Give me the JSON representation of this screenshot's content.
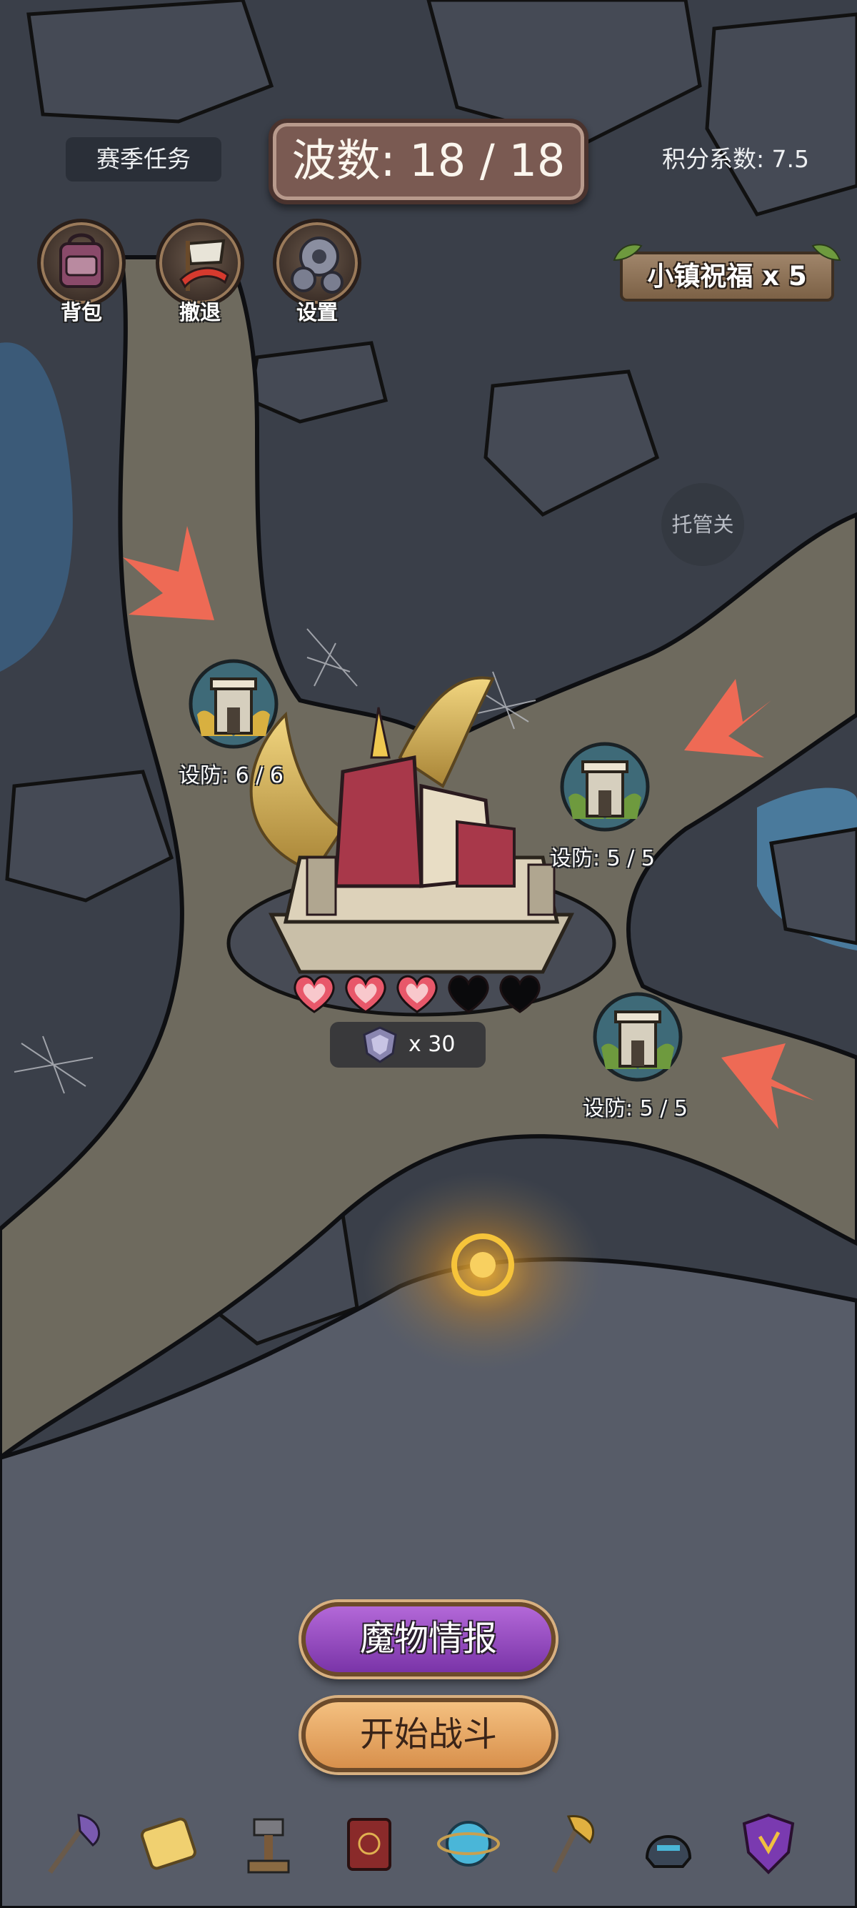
{
  "header": {
    "season_tasks": "赛季任务",
    "wave": "波数: 18 / 18",
    "score_coefficient": "积分系数: 7.5"
  },
  "tools": [
    {
      "label": "背包",
      "icon": "backpack-icon"
    },
    {
      "label": "撤退",
      "icon": "retreat-flag-icon"
    },
    {
      "label": "设置",
      "icon": "gear-icon"
    }
  ],
  "blessing": "小镇祝福 x 5",
  "auto_button": "托管关",
  "towers": [
    {
      "label": "设防: 6 / 6"
    },
    {
      "label": "设防: 5 / 5"
    },
    {
      "label": "设防: 5 / 5"
    }
  ],
  "castle": {
    "hearts_filled": 3,
    "hearts_total": 5,
    "rank_count": "x 30"
  },
  "buttons": {
    "monster_intel": "魔物情报",
    "start_battle": "开始战斗"
  },
  "bottom_bar": [
    "axe-icon",
    "ticket-icon",
    "hammer-anvil-icon",
    "spellbook-icon",
    "magic-orb-icon",
    "winged-axe-icon",
    "helmet-icon",
    "shield-icon"
  ],
  "colors": {
    "ground": "#3c414b",
    "path": "#6e6a5e",
    "arrow": "#ee6a55",
    "heart": "#e8586a",
    "purple_button": "#9a4cc6",
    "orange_button": "#eaaa66"
  }
}
